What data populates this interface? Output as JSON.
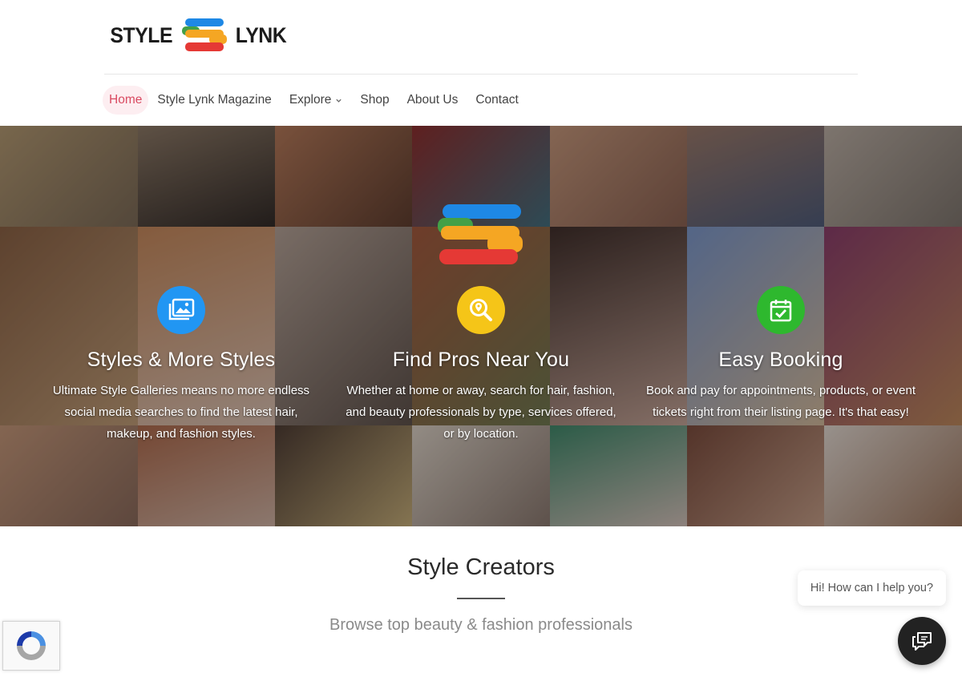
{
  "brand": {
    "left_word": "STYLE",
    "right_word": "LYNK"
  },
  "nav": {
    "items": [
      {
        "label": "Home"
      },
      {
        "label": "Style Lynk Magazine"
      },
      {
        "label": "Explore"
      },
      {
        "label": "Shop"
      },
      {
        "label": "About Us"
      },
      {
        "label": "Contact"
      }
    ]
  },
  "features": [
    {
      "icon": "gallery-icon",
      "color": "#2196f3",
      "title": "Styles & More Styles",
      "text": "Ultimate Style Galleries means no more endless social media searches to find the latest hair, makeup, and fashion styles."
    },
    {
      "icon": "search-location-icon",
      "color": "#f5c518",
      "title": "Find Pros Near You",
      "text": "Whether at home or away, search for hair, fashion, and beauty professionals by type, services offered, or by location."
    },
    {
      "icon": "calendar-check-icon",
      "color": "#2eb82e",
      "title": "Easy Booking",
      "text": "Book and pay for appointments, products, or event tickets right from their listing page. It's that easy!"
    }
  ],
  "section": {
    "title": "Style Creators",
    "subtitle": "Browse top beauty & fashion professionals"
  },
  "chat": {
    "greeting": "Hi! How can I help you?"
  },
  "colors": {
    "accent": "#d94a61",
    "logo_blue": "#1e88e5",
    "logo_orange": "#f5a623",
    "logo_green": "#43a047",
    "logo_red": "#e53935"
  }
}
